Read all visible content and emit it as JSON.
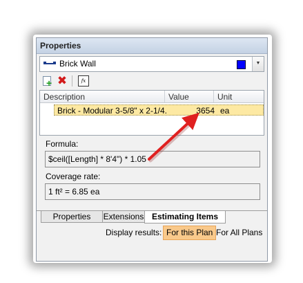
{
  "window": {
    "title": "Properties"
  },
  "object_selector": {
    "label": "Brick Wall",
    "color": "#0000ff",
    "icon": "wall-line-icon",
    "dropdown_glyph": "▼"
  },
  "toolbar": {
    "add_icon": "add-item-icon",
    "delete_icon": "delete-icon",
    "delete_glyph": "✖",
    "formula_icon": "formula-editor-icon",
    "formula_glyph": "fx"
  },
  "grid": {
    "headers": {
      "description": "Description",
      "value": "Value",
      "unit": "Unit"
    },
    "rows": [
      {
        "description": "Brick - Modular 3-5/8\" x 2-1/4...",
        "value": "3654",
        "unit": "ea"
      }
    ],
    "selected_color": "#fde9a3"
  },
  "formula": {
    "label": "Formula:",
    "value": "$ceil([Length] * 8'4\") * 1.05"
  },
  "coverage": {
    "label": "Coverage rate:",
    "value": "1 ft² = 6.85 ea"
  },
  "tabs": [
    {
      "label": "Properties",
      "active": false
    },
    {
      "label": "Extensions",
      "active": false
    },
    {
      "label": "Estimating Items",
      "active": true
    }
  ],
  "results": {
    "label": "Display results:",
    "options": [
      {
        "label": "For this Plan",
        "selected": true
      },
      {
        "label": "For All Plans",
        "selected": false
      }
    ]
  },
  "annotation": {
    "arrow_color": "#e02020"
  }
}
